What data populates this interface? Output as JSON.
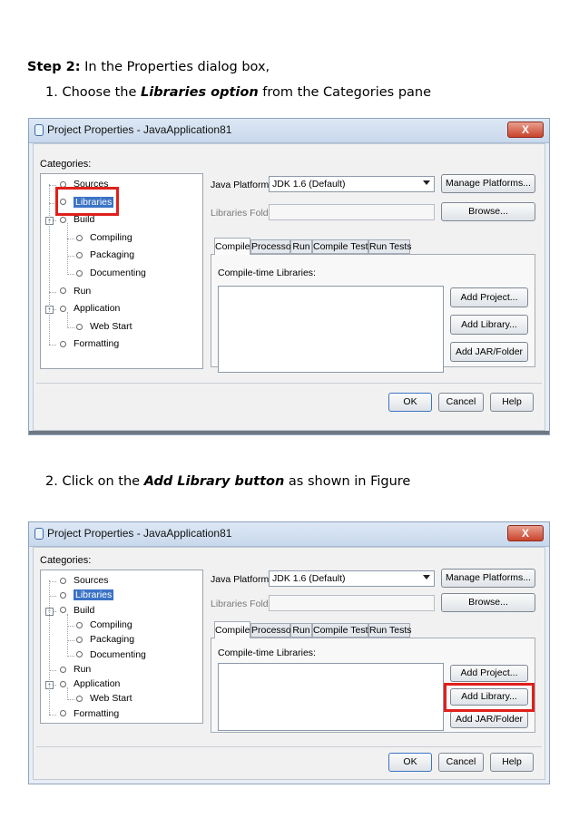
{
  "doc": {
    "step_heading": "Step 2:",
    "step_text": " In the Properties dialog box,",
    "item1": {
      "num": "1.",
      "pre": " Choose the ",
      "emph": "Libraries option",
      "post": " from the Categories pane"
    },
    "item2": {
      "num": "2.",
      "pre": " Click on the ",
      "emph": "Add Library button",
      "post": " as shown in Figure"
    }
  },
  "dialog": {
    "title": "Project Properties - JavaApplication81",
    "close_label": "X",
    "categories_label": "Categories:",
    "tree": [
      {
        "label": "Sources",
        "level": 0
      },
      {
        "label": "Libraries",
        "level": 0,
        "selected": true
      },
      {
        "label": "Build",
        "level": 0,
        "expander": "-"
      },
      {
        "label": "Compiling",
        "level": 1
      },
      {
        "label": "Packaging",
        "level": 1
      },
      {
        "label": "Documenting",
        "level": 1
      },
      {
        "label": "Run",
        "level": 0
      },
      {
        "label": "Application",
        "level": 0,
        "expander": "-"
      },
      {
        "label": "Web Start",
        "level": 1
      },
      {
        "label": "Formatting",
        "level": 0
      }
    ],
    "java_platform_label": "Java Platform:",
    "java_platform_value": "JDK 1.6 (Default)",
    "manage_platforms": "Manage Platforms...",
    "libraries_folder_label": "Libraries Folder:",
    "libraries_folder_value": "",
    "browse": "Browse...",
    "tabs": [
      "Compile",
      "Processor",
      "Run",
      "Compile Tests",
      "Run Tests"
    ],
    "active_tab": "Compile",
    "compile_time_label": "Compile-time Libraries:",
    "add_project": "Add Project...",
    "add_library": "Add Library...",
    "add_jar": "Add JAR/Folder",
    "ok": "OK",
    "cancel": "Cancel",
    "help": "Help"
  },
  "colors": {
    "highlight": "#e0201b",
    "selection": "#3b73c6",
    "close_button": "#c9432c"
  }
}
